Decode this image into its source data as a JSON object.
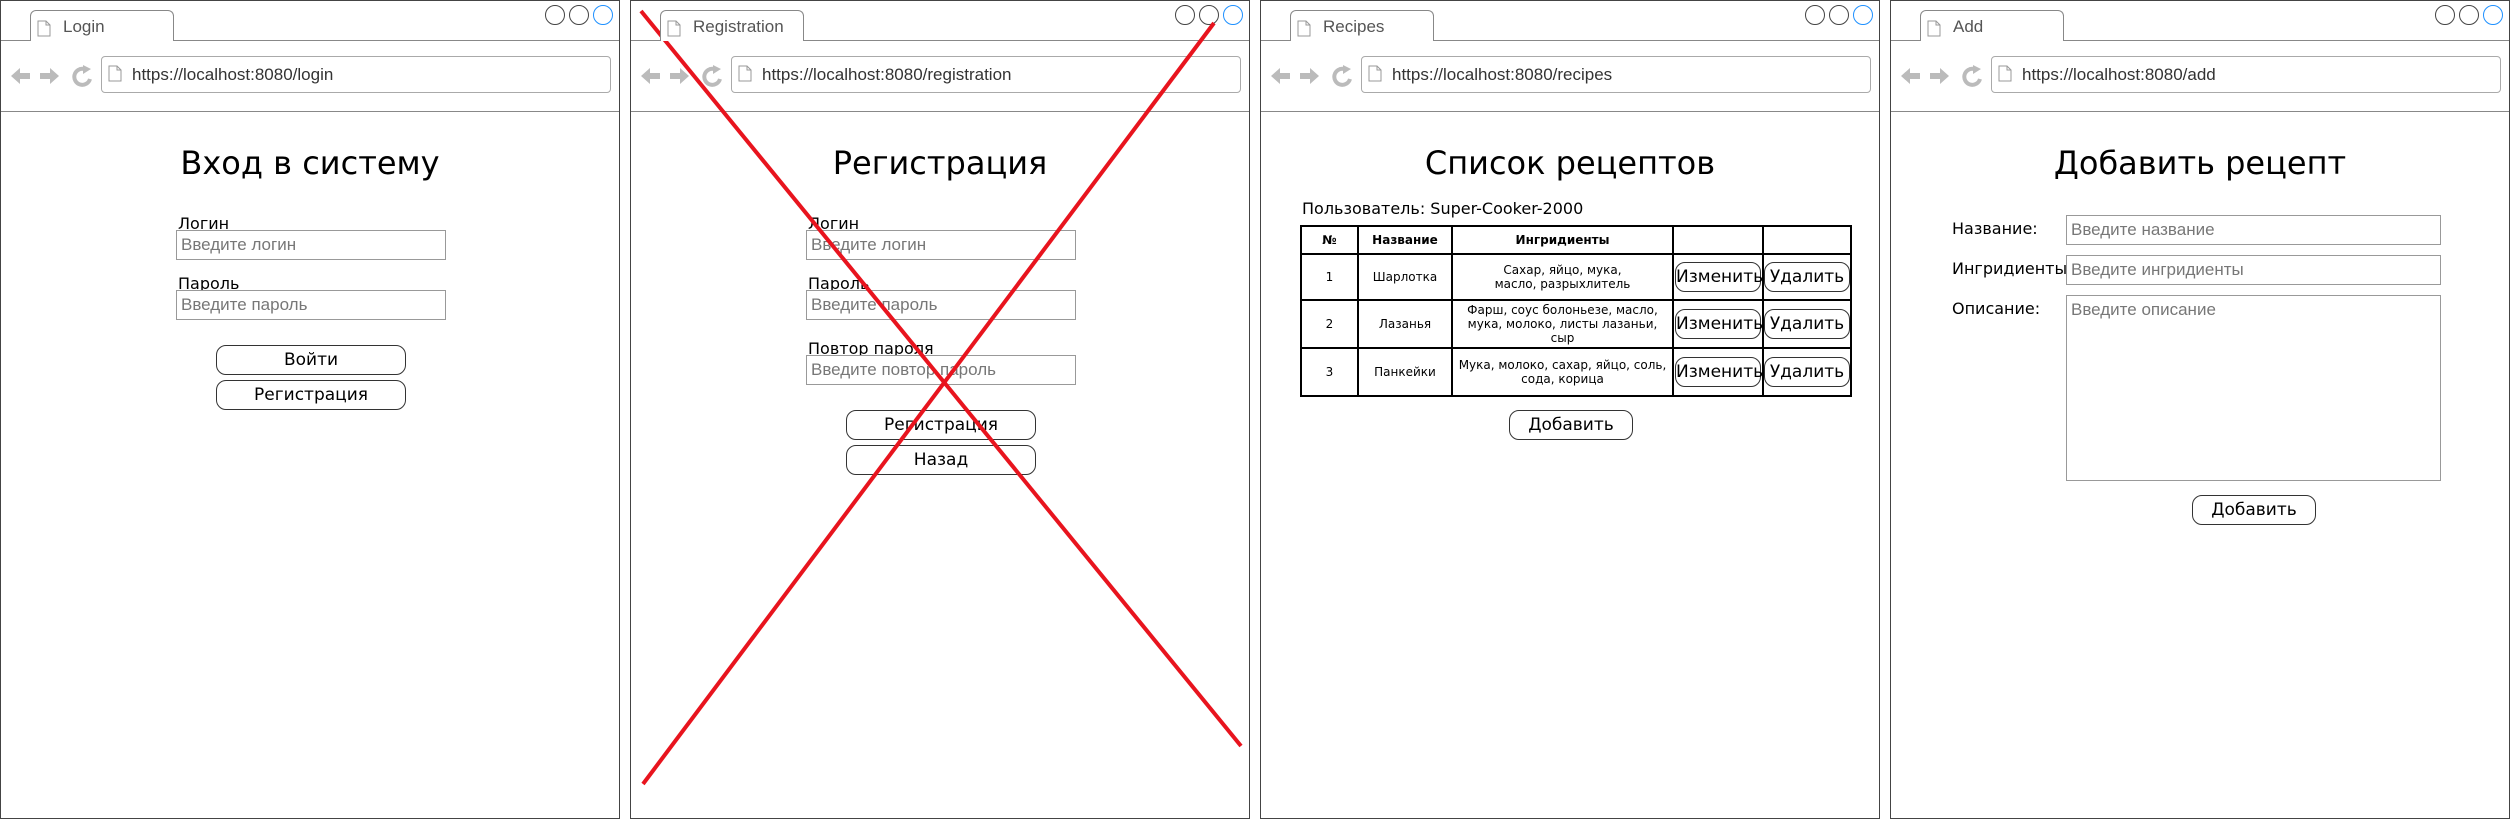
{
  "windows": {
    "login": {
      "tab_title": "Login",
      "url": "https://localhost:8080/login",
      "heading": "Вход в систему",
      "login_label": "Логин",
      "login_placeholder": "Введите логин",
      "password_label": "Пароль",
      "password_placeholder": "Введите пароль",
      "login_button": "Войти",
      "register_button": "Регистрация"
    },
    "registration": {
      "tab_title": "Registration",
      "url": "https://localhost:8080/registration",
      "heading": "Регистрация",
      "login_label": "Логин",
      "login_placeholder": "Введите логин",
      "password_label": "Пароль",
      "password_placeholder": "Введите пароль",
      "repeat_label": "Повтор пароля",
      "repeat_placeholder": "Введите повтор пароль",
      "register_button": "Регистрация",
      "back_button": "Назад",
      "crossed_out": true,
      "cross_color": "#e8141e"
    },
    "recipes": {
      "tab_title": "Recipes",
      "url": "https://localhost:8080/recipes",
      "heading": "Список рецептов",
      "user_text": "Пользователь: Super-Cooker-2000",
      "columns": [
        "№",
        "Название",
        "Ингридиенты",
        "",
        ""
      ],
      "rows": [
        {
          "num": "1",
          "name": "Шарлотка",
          "ingredients": "Сахар, яйцо, мука, масло, разрыхлитель",
          "edit": "Изменить",
          "delete": "Удалить"
        },
        {
          "num": "2",
          "name": "Лазанья",
          "ingredients": "Фарш, соус болоньезе, масло, мука, молоко, листы лазаньи, сыр",
          "edit": "Изменить",
          "delete": "Удалить"
        },
        {
          "num": "3",
          "name": "Панкейки",
          "ingredients": "Мука, молоко, сахар, яйцо, соль, сода, корица",
          "edit": "Изменить",
          "delete": "Удалить"
        }
      ],
      "add_button": "Добавить"
    },
    "add": {
      "tab_title": "Add",
      "url": "https://localhost:8080/add",
      "heading": "Добавить рецепт",
      "name_label": "Название:",
      "name_placeholder": "Введите название",
      "ingredients_label": "Ингридиенты:",
      "ingredients_placeholder": "Введите ингридиенты",
      "description_label": "Описание:",
      "description_placeholder": "Введите описание",
      "add_button": "Добавить"
    }
  },
  "icons": {
    "tab": "document-icon",
    "nav": [
      "back-arrow-icon",
      "forward-arrow-icon",
      "reload-icon"
    ],
    "window_controls": [
      "minimize-circle-icon",
      "maximize-circle-icon",
      "close-circle-icon"
    ]
  },
  "colors": {
    "window_border": "#444444",
    "close_control": "#1e90ff",
    "placeholder_text": "#777777"
  }
}
